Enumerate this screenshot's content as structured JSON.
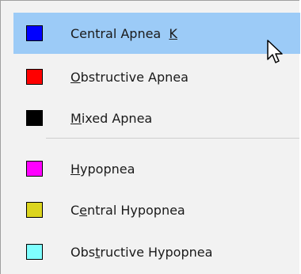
{
  "menu": {
    "items": [
      {
        "pre": "Central Apnea  ",
        "mnemonic": "K",
        "post": "",
        "color": "#0000ff",
        "highlighted": true
      },
      {
        "pre": "",
        "mnemonic": "O",
        "post": "bstructive Apnea",
        "color": "#ff0000",
        "highlighted": false
      },
      {
        "pre": "",
        "mnemonic": "M",
        "post": "ixed Apnea",
        "color": "#000000",
        "highlighted": false
      },
      {
        "pre": "",
        "mnemonic": "H",
        "post": "ypopnea",
        "color": "#ff00ff",
        "highlighted": false
      },
      {
        "pre": "C",
        "mnemonic": "e",
        "post": "ntral Hypopnea",
        "color": "#dcd51e",
        "highlighted": false
      },
      {
        "pre": "Obs",
        "mnemonic": "t",
        "post": "ructive Hypopnea",
        "color": "#7fffff",
        "highlighted": false
      }
    ]
  },
  "colors": {
    "highlight": "#9ccbf7",
    "menu_background": "#f2f2f2"
  },
  "cursor": {
    "icon": "arrow-cursor-icon"
  }
}
